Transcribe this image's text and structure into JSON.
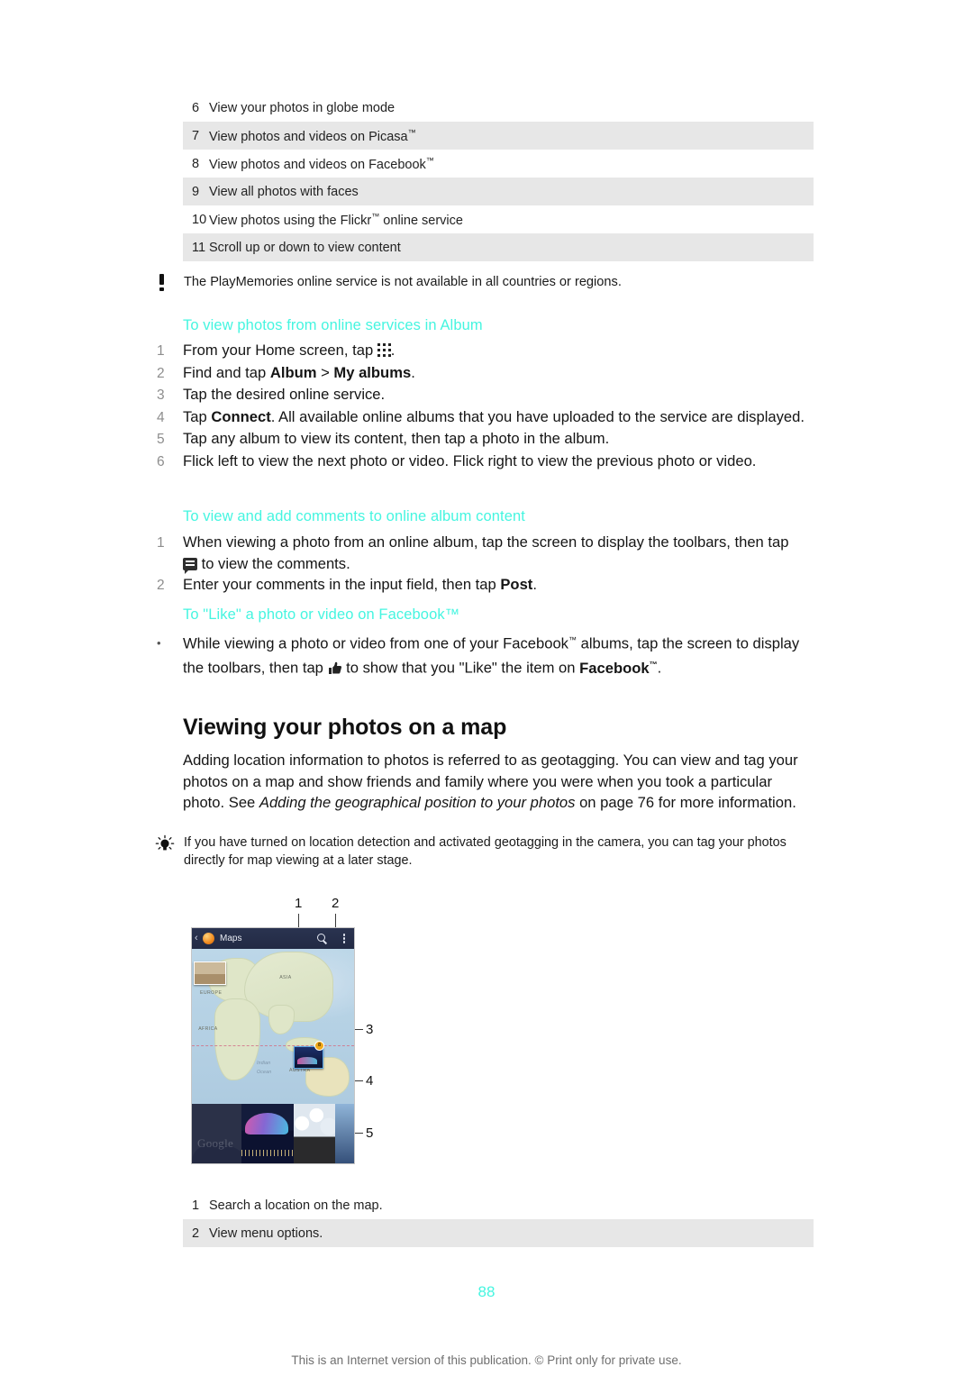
{
  "legend_top": {
    "rows": [
      {
        "num": "6",
        "text": "View your photos in globe mode"
      },
      {
        "num": "7",
        "text": "View photos and videos on Picasa™"
      },
      {
        "num": "8",
        "text": "View photos and videos on Facebook™"
      },
      {
        "num": "9",
        "text": "View all photos with faces"
      },
      {
        "num": "10",
        "text": "View photos using the Flickr™ online service"
      },
      {
        "num": "11",
        "text": "Scroll up or down to view content"
      }
    ]
  },
  "note": {
    "icon": "exclamation-icon",
    "text": "The PlayMemories online service is not available in all countries or regions."
  },
  "section_online": {
    "heading": "To view photos from online services in Album",
    "steps": [
      {
        "num": "1",
        "html": "From your Home screen, tap <span class=\"ic ic-apps\" data-name=\"app-drawer-icon\" data-interactable=\"false\"><s style=\"left:0;top:0\"></s><s style=\"left:6px;top:0\"></s><s style=\"left:12px;top:0\"></s><s style=\"left:0;top:6px\"></s><s style=\"left:6px;top:6px\"></s><s style=\"left:12px;top:6px\"></s><s style=\"left:0;top:12px\"></s><s style=\"left:6px;top:12px\"></s><s style=\"left:12px;top:12px\"></s></span>."
      },
      {
        "num": "2",
        "html": "Find and tap <b class=\"strong\">Album</b> &gt; <b class=\"strong\">My albums</b>."
      },
      {
        "num": "3",
        "html": "Tap the desired online service."
      },
      {
        "num": "4",
        "html": "Tap <b class=\"strong\">Connect</b>. All available online albums that you have uploaded to the service are displayed."
      },
      {
        "num": "5",
        "html": "Tap any album to view its content, then tap a photo in the album."
      },
      {
        "num": "6",
        "html": "Flick left to view the next photo or video. Flick right to view the previous photo or video."
      }
    ]
  },
  "section_comments": {
    "heading": "To view and add comments to online album content",
    "steps": [
      {
        "num": "1",
        "html": "When viewing a photo from an online album, tap the screen to display the toolbars, then tap <span class=\"ic ic-comment\" data-name=\"comment-icon\" data-interactable=\"false\"><em></em></span> to view the comments."
      },
      {
        "num": "2",
        "html": "Enter your comments in the input field, then tap <b class=\"strong\">Post</b>."
      }
    ]
  },
  "section_like": {
    "heading": "To \"Like\" a photo or video on Facebook™",
    "steps": [
      {
        "num": "•",
        "html": "While viewing a photo or video from one of your Facebook™ albums, tap the screen to display the toolbars, then tap <span class=\"ic ic-thumb\" data-name=\"thumbs-up-icon\" data-interactable=\"false\"><svg width=\"16\" height=\"15\" viewBox=\"0 0 16 15\"><path fill=\"#232323\" d=\"M1 7h3v7H1zM5.2 6.6C6.6 5.6 7.6 4 7.8 2.1 7.9 1.1 8.6.6 9.3.8c.8.2 1.2 1 1 2L10 5h3.6c1 0 1.7.9 1.4 1.8l-1.5 5.4c-.2.8-.9 1.3-1.7 1.3H5.2z\"/></svg></span> to show that you \"Like\" the item on <b class=\"strong\">Facebook™</b>."
      }
    ]
  },
  "chapter": {
    "heading": "Viewing your photos on a map",
    "paragraph_html": "Adding location information to photos is referred to as geotagging. You can view and tag your photos on a map and show friends and family where you were when you took a particular photo. See <i class=\"em\">Adding the geographical position to your photos</i> on page 76 for more information."
  },
  "tip": {
    "icon": "lightbulb-icon",
    "text": "If you have turned on location detection and activated geotagging in the camera, you can tag your photos directly for map viewing at a later stage."
  },
  "figure": {
    "app_title": "Maps",
    "map_labels": {
      "asia": "ASIA",
      "europe": "EUROPE",
      "africa": "AFRICA",
      "australia": "AUSTRA",
      "indian_ocean_line1": "Indian",
      "indian_ocean_line2": "Ocean"
    },
    "pin_badge": "8",
    "watermark": "Google",
    "callouts": [
      {
        "id": "1",
        "label": "1"
      },
      {
        "id": "2",
        "label": "2"
      },
      {
        "id": "3",
        "label": "3"
      },
      {
        "id": "4",
        "label": "4"
      },
      {
        "id": "5",
        "label": "5"
      }
    ]
  },
  "legend_bottom": {
    "rows": [
      {
        "num": "1",
        "text": "Search a location on the map."
      },
      {
        "num": "2",
        "text": "View menu options."
      }
    ]
  },
  "footer": {
    "page_number": "88",
    "notice": "This is an Internet version of this publication. © Print only for private use."
  },
  "colors": {
    "heading_cyan": "#45f5e0",
    "row_shade": "#e7e7e7",
    "text": "#151515"
  }
}
